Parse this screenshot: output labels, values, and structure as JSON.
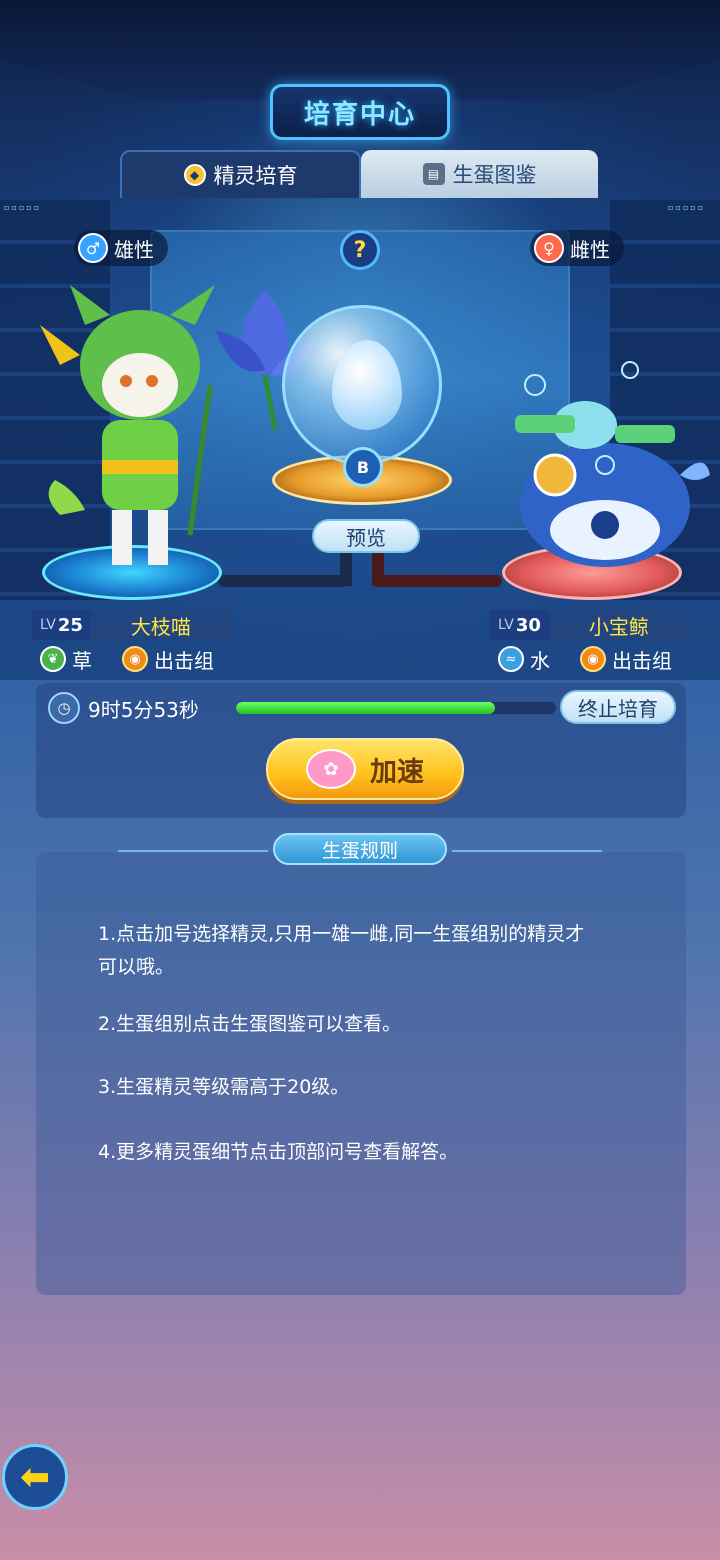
{
  "header": {
    "title": "培育中心"
  },
  "tabs": [
    {
      "label": "精灵培育",
      "icon": "breed-icon",
      "active": true
    },
    {
      "label": "生蛋图鉴",
      "icon": "book-icon",
      "active": false
    }
  ],
  "genders": {
    "male": "雄性",
    "female": "雌性",
    "help": "?"
  },
  "egg": {
    "badge": "B",
    "preview_label": "预览"
  },
  "pets": {
    "left": {
      "lv_prefix": "LV",
      "level": "25",
      "name": "大枝喵",
      "type": "草",
      "group": "出击组"
    },
    "right": {
      "lv_prefix": "LV",
      "level": "30",
      "name": "小宝鲸",
      "type": "水",
      "group": "出击组"
    }
  },
  "progress": {
    "timer": "9时5分53秒",
    "fraction": 0.81,
    "stop_label": "终止培育"
  },
  "speed": {
    "label": "加速"
  },
  "rules": {
    "title": "生蛋规则",
    "items": [
      "1.点击加号选择精灵,只用一雄一雌,同一生蛋组别的精灵才可以哦。",
      "2.生蛋组别点击生蛋图鉴可以查看。",
      "3.生蛋精灵等级需高于20级。",
      "4.更多精灵蛋细节点击顶部问号查看解答。"
    ]
  },
  "colors": {
    "accent": "#4fc3ff",
    "progress": "#2ed42a",
    "name": "#ffe34a",
    "speed": "#ffc21a"
  }
}
